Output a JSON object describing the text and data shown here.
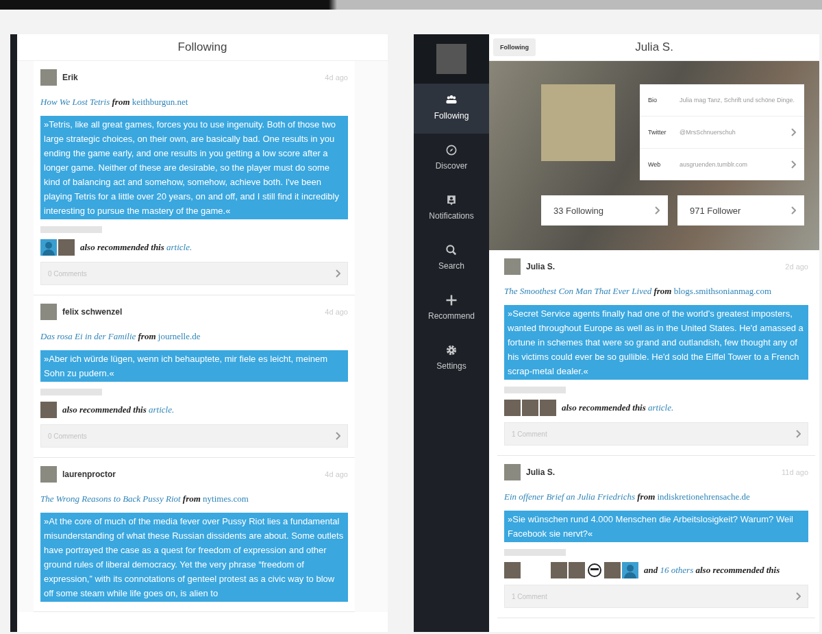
{
  "left_screen": {
    "title": "Following",
    "posts": [
      {
        "user": "Erik",
        "time": "4d ago",
        "article": "How We Lost Tetris",
        "from": "from",
        "source": "keithburgun.net",
        "quote": "»Tetris, like all great games, forces you to use ingenuity. Both of those two large strategic choices, on their own, are basically bad. One results in you ending the game early, and one results in you getting a low score after a longer game. Neither of these are desirable, so the player must do some kind of balancing act and somehow, somehow, achieve both. I've been playing Tetris for a little over 20 years, on and off, and I still find it incredibly interesting to pursue the mastery of the game.«",
        "recommenders": [
          {
            "kind": "silhouette"
          },
          {
            "kind": "photo"
          }
        ],
        "note": [
          {
            "kind": "text",
            "text": "also recommended this"
          },
          {
            "kind": "link",
            "text": "article."
          }
        ],
        "comments": "0 Comments"
      },
      {
        "user": "felix schwenzel",
        "time": "4d ago",
        "article": "Das rosa Ei in der Familie",
        "from": "from",
        "source": "journelle.de",
        "quote": "»Aber ich würde lügen, wenn ich behauptete, mir fiele es leicht, meinem Sohn zu pudern.«",
        "recommenders": [
          {
            "kind": "photo"
          }
        ],
        "note": [
          {
            "kind": "text",
            "text": "also recommended this"
          },
          {
            "kind": "link",
            "text": "article."
          }
        ],
        "comments": "0 Comments"
      },
      {
        "user": "laurenproctor",
        "time": "4d ago",
        "article": "The Wrong Reasons to Back Pussy Riot",
        "from": "from",
        "source": "nytimes.com",
        "quote": "»At the core of much of the media fever over Pussy Riot lies a fundamental misunderstanding of what these Russian dissidents are about. Some outlets have portrayed the case as a quest for freedom of expression and other ground rules of liberal democracy. Yet the very phrase “freedom of expression,” with its connotations of genteel protest as a civic way to blow off some steam while life goes on, is alien to"
      }
    ]
  },
  "right_screen": {
    "sidebar": [
      {
        "kind": "people",
        "label": "Following",
        "selected": true
      },
      {
        "kind": "compass",
        "label": "Discover",
        "selected": false
      },
      {
        "kind": "badge",
        "label": "Notifications",
        "selected": false
      },
      {
        "kind": "search",
        "label": "Search",
        "selected": false
      },
      {
        "kind": "plus",
        "label": "Recommend",
        "selected": false
      },
      {
        "kind": "gear",
        "label": "Settings",
        "selected": false
      }
    ],
    "back_button": "Following",
    "title": "Julia S.",
    "profile": {
      "rows": [
        {
          "label": "Bio",
          "value": "Julia mag Tanz, Schrift und schöne Dinge.",
          "link": false
        },
        {
          "label": "Twitter",
          "value": "@MrsSchnuerschuh",
          "link": true
        },
        {
          "label": "Web",
          "value": "ausgruenden.tumblr.com",
          "link": true
        }
      ],
      "stats": [
        "33 Following",
        "971 Follower"
      ]
    },
    "posts": [
      {
        "user": "Julia S.",
        "time": "2d ago",
        "article": "The Smoothest Con Man That Ever Lived",
        "from": "from",
        "source": "blogs.smithsonianmag.com",
        "quote": "»Secret Service agents finally had one of the world's greatest imposters, wanted throughout Europe as well as in the United States.  He'd amassed a fortune in schemes that were so grand and outlandish, few thought any of his victims could ever be so gullible. He'd sold the Eiffel Tower to a French scrap-metal dealer.«",
        "recommenders": [
          {
            "kind": "photo"
          },
          {
            "kind": "photo"
          },
          {
            "kind": "photo"
          }
        ],
        "note": [
          {
            "kind": "text",
            "text": "also recommended this"
          },
          {
            "kind": "link",
            "text": "article."
          }
        ],
        "comments": "1 Comment"
      },
      {
        "user": "Julia S.",
        "time": "11d ago",
        "article": "Ein offener Brief an Julia Friedrichs",
        "from": "from",
        "source": "indiskretionehrensache.de",
        "quote": "»Sie wünschen rund 4.000 Menschen die Arbeitslosigkeit? Warum? Weil Facebook sie nervt?«",
        "recommenders": [
          {
            "kind": "photo"
          },
          {
            "kind": "gap"
          },
          {
            "kind": "photo"
          },
          {
            "kind": "photo"
          },
          {
            "kind": "icon"
          },
          {
            "kind": "photo"
          },
          {
            "kind": "silhouette"
          }
        ],
        "note": [
          {
            "kind": "text",
            "text": "and"
          },
          {
            "kind": "link",
            "text": "16 others"
          },
          {
            "kind": "text",
            "text": "also recommended this"
          }
        ],
        "comments": "1 Comment"
      }
    ]
  }
}
